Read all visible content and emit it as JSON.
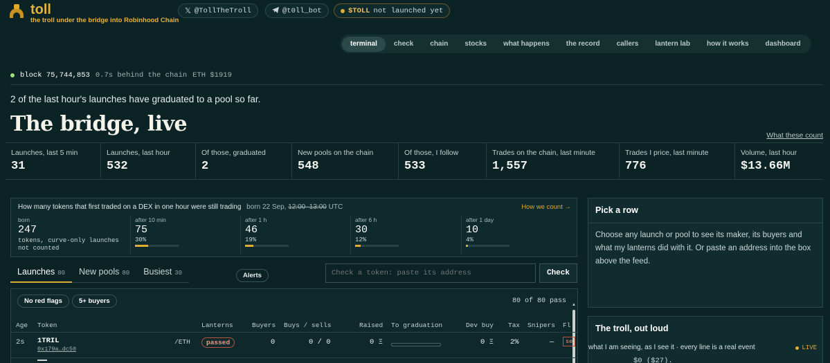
{
  "brand": {
    "name": "toll",
    "tagline": "the troll under the bridge into Robinhood Chain"
  },
  "links": {
    "x": {
      "icon": "x-icon",
      "label": "@TollTheTroll"
    },
    "telegram": {
      "icon": "telegram-icon",
      "label": "@t0ll_bot"
    },
    "token": {
      "icon": "status-dot-icon",
      "symbol": "$TOLL",
      "status": "not launched yet",
      "color": "#e2ad34"
    }
  },
  "nav": {
    "tabs": [
      "terminal",
      "check",
      "chain",
      "stocks",
      "what happens",
      "the record",
      "callers",
      "lantern lab",
      "how it works",
      "dashboard"
    ],
    "active": "terminal"
  },
  "chainstatus": {
    "block_label": "block",
    "block": "75,744,853",
    "behind": "0.7s behind the chain",
    "eth": "ETH $1919",
    "dot_color": "#9fe07a"
  },
  "headline": "2 of the last hour's launches have graduated to a pool so far.",
  "title": "The bridge, live",
  "what_count_link": "What these count",
  "stats": [
    {
      "label": "Launches, last 5 min",
      "value": "31"
    },
    {
      "label": "Launches, last hour",
      "value": "532"
    },
    {
      "label": "Of those, graduated",
      "value": "2"
    },
    {
      "label": "New pools on the chain",
      "value": "548"
    },
    {
      "label": "Of those, I follow",
      "value": "533"
    },
    {
      "label": "Trades on the chain, last minute",
      "value": "1,557"
    },
    {
      "label": "Trades I price, last minute",
      "value": "776"
    },
    {
      "label": "Volume, last hour",
      "value": "$13.66M"
    }
  ],
  "cohort": {
    "question": "How many tokens that first traded on a DEX in one hour were still trading",
    "born_prefix": "born 22 Sep, ",
    "born_range": "12:00–13:00",
    "born_suffix": " UTC",
    "how_link": "How we count →",
    "born": {
      "label": "born",
      "value": "247",
      "desc1": "tokens, curve-only launches",
      "desc2": "not counted"
    },
    "checkpoints": [
      {
        "label": "after 10 min",
        "value": "75",
        "pct": "30%",
        "fraction": 0.3
      },
      {
        "label": "after 1 h",
        "value": "46",
        "pct": "19%",
        "fraction": 0.19
      },
      {
        "label": "after 6 h",
        "value": "30",
        "pct": "12%",
        "fraction": 0.12
      },
      {
        "label": "after 1 day",
        "value": "10",
        "pct": "4%",
        "fraction": 0.04
      }
    ]
  },
  "feedtabs": [
    {
      "label": "Launches",
      "count": "80",
      "active": true
    },
    {
      "label": "New pools",
      "count": "80",
      "active": false
    },
    {
      "label": "Busiest",
      "count": "30",
      "active": false
    }
  ],
  "alerts_label": "Alerts",
  "check": {
    "placeholder": "Check a token: paste its address",
    "button": "Check"
  },
  "filters": {
    "chip1": "No red flags",
    "chip2": "5+ buyers",
    "pass_count": "80 of 80 pass"
  },
  "table": {
    "headers": [
      "Age",
      "Token",
      "Lanterns",
      "Buyers",
      "Buys / sells",
      "Raised",
      "To graduation",
      "Dev buy",
      "Tax",
      "Snipers",
      "Fl"
    ],
    "rows": [
      {
        "age": "2s",
        "token": "1TRIL",
        "address": "0x179a…dc50",
        "pair": "/ETH",
        "lanterns": "passed",
        "buyers": "0",
        "buys_sells": "0 / 0",
        "raised": "0 Ξ",
        "graduation": 0,
        "dev_buy": "0 Ξ",
        "tax": "2%",
        "snipers": "—",
        "flag": "se"
      }
    ]
  },
  "pick": {
    "title": "Pick a row",
    "body": "Choose any launch or pool to see its maker, its buyers and what my lanterns did with it. Or paste an address into the box above the feed."
  },
  "troll": {
    "title": "The troll, out loud",
    "sub": "what I am seeing, as I see it · every line is a real event",
    "live": "LIVE",
    "line": "$0 ($27)."
  }
}
